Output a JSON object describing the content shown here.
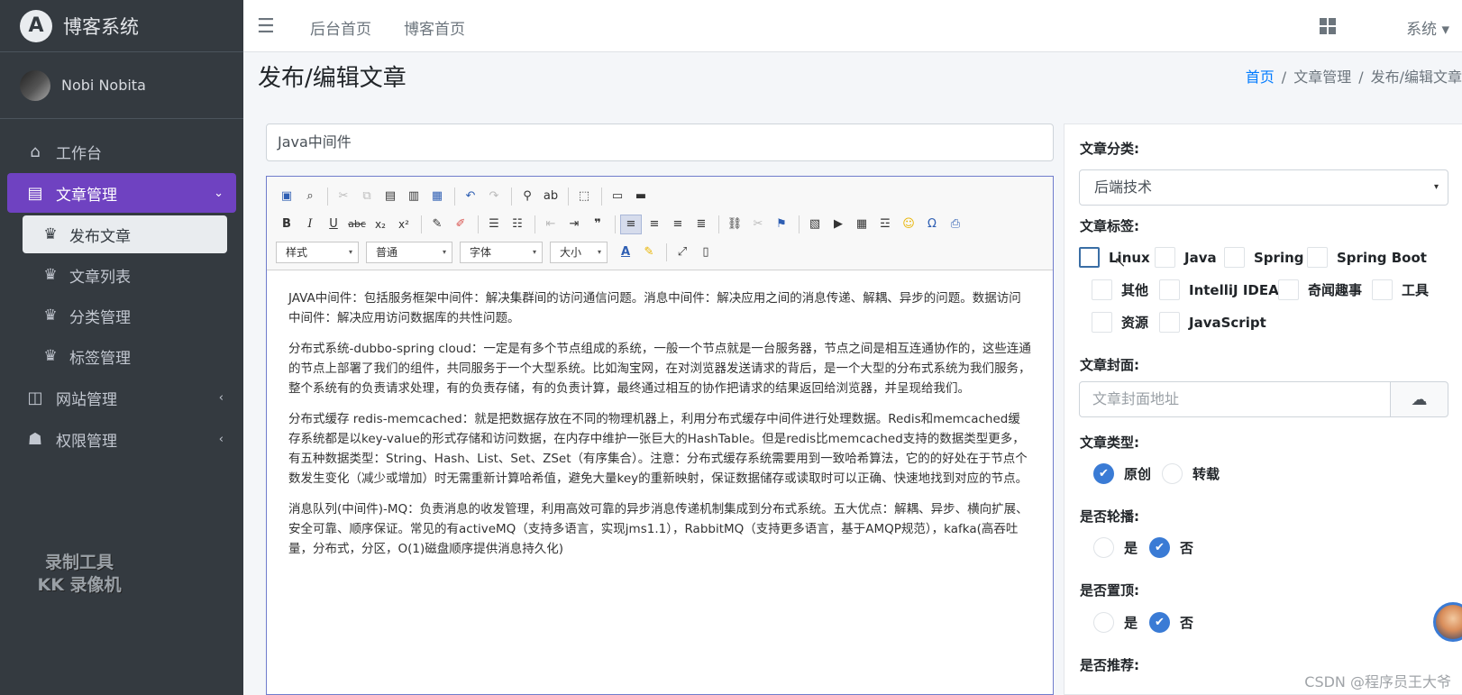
{
  "brand": {
    "logo_letter": "A",
    "name": "博客系统"
  },
  "user": {
    "name": "Nobi Nobita"
  },
  "sidebar": {
    "items": [
      {
        "icon": "home-icon",
        "glyph": "⌂",
        "label": "工作台"
      },
      {
        "icon": "list-icon",
        "glyph": "▤",
        "label": "文章管理",
        "active": true
      },
      {
        "icon": "globe-icon",
        "glyph": "◫",
        "label": "网站管理"
      },
      {
        "icon": "user-lock-icon",
        "glyph": "☗",
        "label": "权限管理"
      }
    ],
    "subitems": [
      {
        "icon": "crown-icon",
        "glyph": "♛",
        "label": "发布文章",
        "active": true
      },
      {
        "icon": "crown-icon",
        "glyph": "♛",
        "label": "文章列表"
      },
      {
        "icon": "crown-icon",
        "glyph": "♛",
        "label": "分类管理"
      },
      {
        "icon": "crown-icon",
        "glyph": "♛",
        "label": "标签管理"
      }
    ],
    "chevron_down": "⌄",
    "chevron_left": "‹"
  },
  "watermark": {
    "line1": "录制工具",
    "line2": "KK 录像机"
  },
  "topnav": {
    "menu_icon": "☰",
    "links": [
      "后台首页",
      "博客首页"
    ],
    "system_menu": "系统 ▾"
  },
  "page": {
    "title": "发布/编辑文章",
    "breadcrumb": [
      "首页",
      "文章管理",
      "发布/编辑文章"
    ],
    "breadcrumb_sep": "/"
  },
  "article": {
    "title_value": "Java中间件",
    "toolbar": {
      "combos": [
        "样式",
        "普通",
        "字体",
        "大小"
      ],
      "combo_arrow": "▾"
    },
    "paragraphs": [
      "JAVA中间件：包括服务框架中间件：解决集群间的访问通信问题。消息中间件：解决应用之间的消息传递、解耦、异步的问题。数据访问中间件：解决应用访问数据库的共性问题。",
      "分布式系统-dubbo-spring cloud：一定是有多个节点组成的系统，一般一个节点就是一台服务器，节点之间是相互连通协作的，这些连通的节点上部署了我们的组件，共同服务于一个大型系统。比如淘宝网，在对浏览器发送请求的背后，是一个大型的分布式系统为我们服务，整个系统有的负责请求处理，有的负责存储，有的负责计算，最终通过相互的协作把请求的结果返回给浏览器，并呈现给我们。",
      "分布式缓存 redis-memcached：就是把数据存放在不同的物理机器上，利用分布式缓存中间件进行处理数据。Redis和memcached缓存系统都是以key-value的形式存储和访问数据，在内存中维护一张巨大的HashTable。但是redis比memcached支持的数据类型更多，有五种数据类型：String、Hash、List、Set、ZSet（有序集合）。注意：分布式缓存系统需要用到一致哈希算法，它的的好处在于节点个数发生变化（减少或增加）时无需重新计算哈希值，避免大量key的重新映射，保证数据储存或读取时可以正确、快速地找到对应的节点。",
      "消息队列(中间件)-MQ：负责消息的收发管理，利用高效可靠的异步消息传递机制集成到分布式系统。五大优点：解耦、异步、横向扩展、安全可靠、顺序保证。常见的有activeMQ（支持多语言，实现jms1.1），RabbitMQ（支持更多语言，基于AMQP规范），kafka(高吞吐量，分布式，分区，O(1)磁盘顺序提供消息持久化)"
    ]
  },
  "form": {
    "category_label": "文章分类:",
    "category_value": "后端技术",
    "select_arrow": "▾",
    "tags_label": "文章标签:",
    "tags": [
      "Linux",
      "Java",
      "Spring",
      "Spring Boot",
      "其他",
      "IntelliJ IDEA",
      "奇闻趣事",
      "工具",
      "资源",
      "JavaScript"
    ],
    "cover_label": "文章封面:",
    "cover_placeholder": "文章封面地址",
    "upload_glyph": "☁",
    "type_label": "文章类型:",
    "type_options": [
      "原创",
      "转载"
    ],
    "carousel_label": "是否轮播:",
    "top_label": "是否置顶:",
    "yes": "是",
    "no": "否",
    "check_glyph": "✔",
    "recommend_label": "是否推荐:"
  },
  "footer_watermark": "CSDN @程序员王大爷",
  "colors": {
    "sidebar_bg": "#343a40",
    "accent": "#6f42c1",
    "link": "#007bff",
    "radio_on": "#3a7bd5"
  }
}
